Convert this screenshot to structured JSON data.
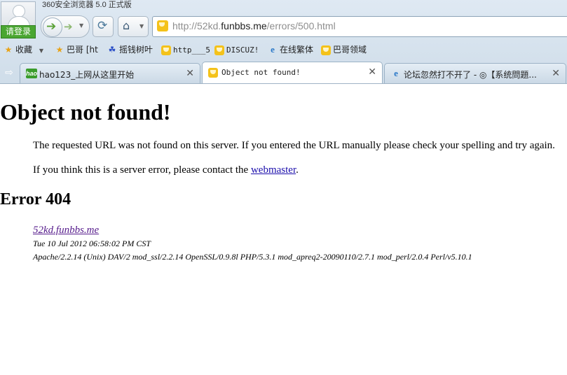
{
  "browser": {
    "title": "360安全浏览器 5.0 正式版",
    "login_label": "请登录",
    "address": {
      "prefix": "http://52kd.",
      "domain": "funbbs.me",
      "path": "/errors/500.html"
    },
    "bookmarks": [
      {
        "label": "收藏",
        "icon": "star-icon"
      },
      {
        "label": "巴哥 [ht",
        "icon": "star-icon"
      },
      {
        "label": "摇钱树叶",
        "icon": "baidu-paw-icon"
      },
      {
        "label": "http___5",
        "icon": "trophy-icon"
      },
      {
        "label": "DISCUZ!",
        "icon": "trophy-icon"
      },
      {
        "label": "在线繁体",
        "icon": "ie-icon"
      },
      {
        "label": "巴哥领域",
        "icon": "trophy-icon"
      }
    ],
    "tabs": [
      {
        "label": "hao123_上网从这里开始",
        "icon": "hao123-icon",
        "active": false
      },
      {
        "label": "Object not found!",
        "icon": "trophy-icon",
        "active": true
      },
      {
        "label": "论坛忽然打不开了 - ◎【系统問題...",
        "icon": "ie-icon",
        "active": false
      }
    ],
    "colors": {
      "login_green": "#4aa631",
      "chrome_blue": "#cfdde9",
      "link": "#1a0dab",
      "visited": "#551a8b"
    }
  },
  "page": {
    "heading": "Object not found!",
    "message": "The requested URL was not found on this server. If you entered the URL manually please check your spelling and try again.",
    "contact_prefix": "If you think this is a server error, please contact the ",
    "contact_link": "webmaster",
    "contact_suffix": ".",
    "error_heading": "Error 404",
    "host": "52kd.funbbs.me",
    "date": "Tue 10 Jul 2012 06:58:02 PM CST",
    "server": "Apache/2.2.14 (Unix) DAV/2 mod_ssl/2.2.14 OpenSSL/0.9.8l PHP/5.3.1 mod_apreq2-20090110/2.7.1 mod_perl/2.0.4 Perl/v5.10.1"
  }
}
